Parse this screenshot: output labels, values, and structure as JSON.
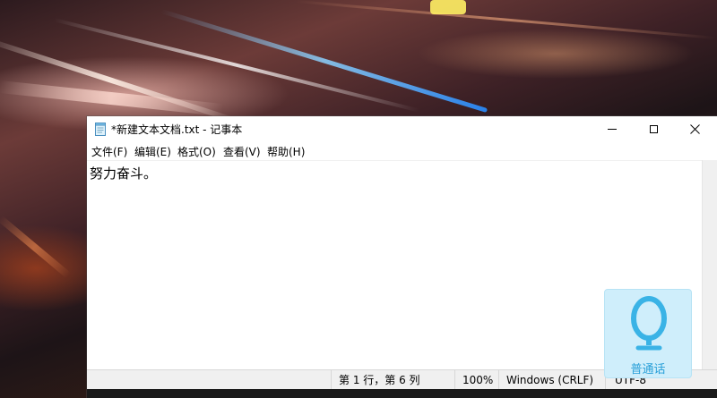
{
  "window": {
    "title": "*新建文本文档.txt - 记事本"
  },
  "menu": {
    "items": [
      "文件(F)",
      "编辑(E)",
      "格式(O)",
      "查看(V)",
      "帮助(H)"
    ]
  },
  "editor": {
    "content": "努力奋斗。"
  },
  "statusbar": {
    "position": "第 1 行，第 6 列",
    "zoom": "100%",
    "line_ending": "Windows (CRLF)",
    "encoding": "UTF-8"
  },
  "voice_widget": {
    "label": "普通话",
    "color": "#2aa0d8"
  },
  "icons": {
    "app": "notepad-icon",
    "minimize": "minimize-icon",
    "maximize": "maximize-icon",
    "close": "close-icon",
    "mic": "microphone-icon"
  }
}
